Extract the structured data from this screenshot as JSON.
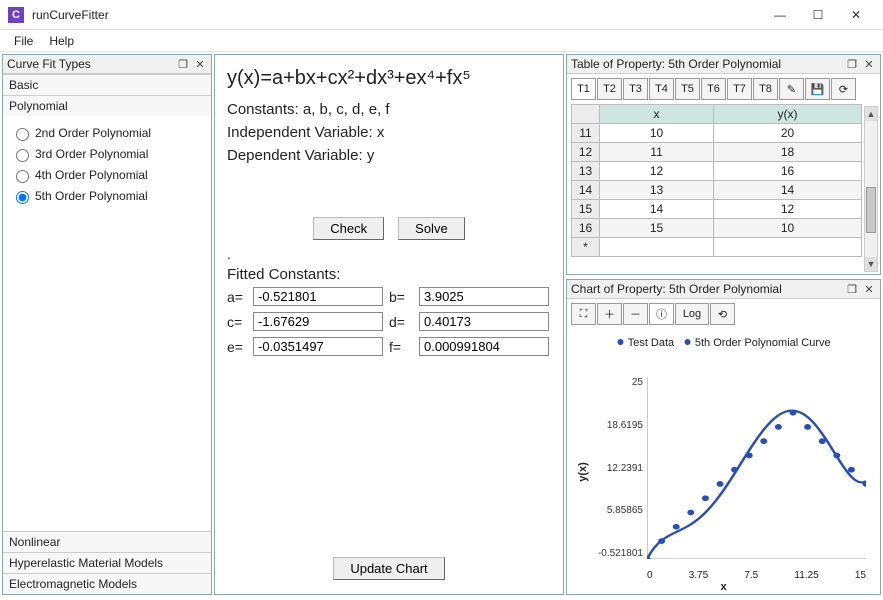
{
  "window": {
    "title": "runCurveFitter"
  },
  "menu": {
    "file": "File",
    "help": "Help"
  },
  "left": {
    "panel_title": "Curve Fit Types",
    "groups": {
      "basic": "Basic",
      "polynomial": "Polynomial",
      "nonlinear": "Nonlinear",
      "hyperelastic": "Hyperelastic Material Models",
      "electromagnetic": "Electromagnetic Models"
    },
    "poly_options": [
      "2nd Order Polynomial",
      "3rd Order Polynomial",
      "4th Order Polynomial",
      "5th Order Polynomial"
    ],
    "selected_index": 3
  },
  "mid": {
    "equation": "y(x)=a+bx+cx²+dx³+ex⁴+fx⁵",
    "constants_line": "Constants: a, b, c, d, e, f",
    "indep_line": "Independent Variable: x",
    "dep_line": "Dependent Variable: y",
    "check": "Check",
    "solve": "Solve",
    "dot": ".",
    "fitted_label": "Fitted Constants:",
    "labels": {
      "a": "a=",
      "b": "b=",
      "c": "c=",
      "d": "d=",
      "e": "e=",
      "f": "f="
    },
    "vals": {
      "a": "-0.521801",
      "b": "3.9025",
      "c": "-1.67629",
      "d": "0.40173",
      "e": "-0.0351497",
      "f": "0.000991804"
    },
    "update": "Update Chart"
  },
  "table": {
    "panel_title": "Table of Property: 5th Order Polynomial",
    "tabs": [
      "T1",
      "T2",
      "T3",
      "T4",
      "T5",
      "T6",
      "T7",
      "T8"
    ],
    "col_x": "x",
    "col_y": "y(x)",
    "rows": [
      {
        "n": "11",
        "x": "10",
        "y": "20"
      },
      {
        "n": "12",
        "x": "11",
        "y": "18"
      },
      {
        "n": "13",
        "x": "12",
        "y": "16"
      },
      {
        "n": "14",
        "x": "13",
        "y": "14"
      },
      {
        "n": "15",
        "x": "14",
        "y": "12"
      },
      {
        "n": "16",
        "x": "15",
        "y": "10"
      }
    ],
    "star": "*"
  },
  "chart": {
    "panel_title": "Chart of Property: 5th Order Polynomial",
    "toolbar": {
      "log": "Log"
    },
    "legend": {
      "test": "Test Data",
      "curve": "5th Order Polynomial Curve"
    },
    "y_ticks": [
      "25",
      "18.6195",
      "12.2391",
      "5.85865",
      "-0.521801"
    ],
    "x_ticks": [
      "0",
      "3.75",
      "7.5",
      "11.25",
      "15"
    ],
    "ylabel": "y(x)",
    "xlabel": "x"
  },
  "chart_data": {
    "type": "scatter+line",
    "xlabel": "x",
    "ylabel": "y(x)",
    "xlim": [
      0,
      15
    ],
    "ylim": [
      -0.521801,
      25
    ],
    "series": [
      {
        "name": "Test Data",
        "kind": "scatter",
        "x": [
          0,
          1,
          2,
          3,
          4,
          5,
          6,
          7,
          8,
          9,
          10,
          11,
          12,
          13,
          14,
          15
        ],
        "y": [
          -0.52,
          2,
          4,
          6,
          8,
          10,
          12,
          14,
          16,
          18,
          20,
          18,
          16,
          14,
          12,
          10
        ]
      },
      {
        "name": "5th Order Polynomial Curve",
        "kind": "line",
        "coeffs": {
          "a": -0.521801,
          "b": 3.9025,
          "c": -1.67629,
          "d": 0.40173,
          "e": -0.0351497,
          "f": 0.000991804
        }
      }
    ]
  }
}
